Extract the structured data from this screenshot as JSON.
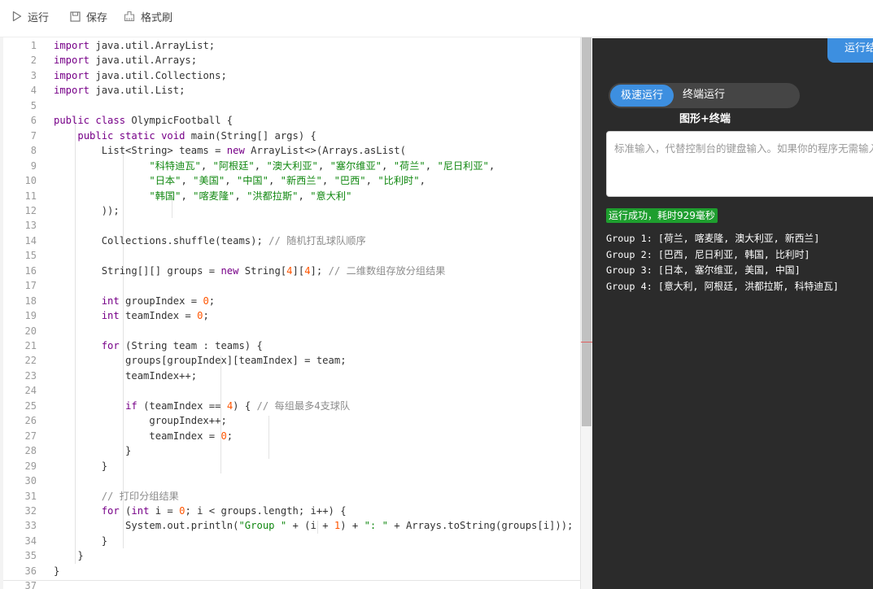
{
  "toolbar": {
    "run": "运行",
    "save": "保存",
    "format": "格式刷"
  },
  "colors": {
    "keyword": "#770088",
    "type": "#0055aa",
    "string": "#118811",
    "number": "#ff5500",
    "comment": "#8c8c8c",
    "accent": "#3d8fe0",
    "success": "#1e9e2e"
  },
  "editor": {
    "lines": [
      [
        [
          "kw",
          "import"
        ],
        [
          "p",
          " java.util.ArrayList;"
        ]
      ],
      [
        [
          "kw",
          "import"
        ],
        [
          "p",
          " java.util.Arrays;"
        ]
      ],
      [
        [
          "kw",
          "import"
        ],
        [
          "p",
          " java.util.Collections;"
        ]
      ],
      [
        [
          "kw",
          "import"
        ],
        [
          "p",
          " java.util.List;"
        ]
      ],
      [],
      [
        [
          "kw",
          "public class"
        ],
        [
          "p",
          " OlympicFootball {"
        ]
      ],
      [
        [
          "p",
          "    "
        ],
        [
          "kw",
          "public static void"
        ],
        [
          "p",
          " main(String[] args) {"
        ]
      ],
      [
        [
          "p",
          "        List<String> teams = "
        ],
        [
          "kw",
          "new"
        ],
        [
          "p",
          " ArrayList<>(Arrays.asList("
        ]
      ],
      [
        [
          "p",
          "                "
        ],
        [
          "str",
          "\"科特迪瓦\""
        ],
        [
          "p",
          ", "
        ],
        [
          "str",
          "\"阿根廷\""
        ],
        [
          "p",
          ", "
        ],
        [
          "str",
          "\"澳大利亚\""
        ],
        [
          "p",
          ", "
        ],
        [
          "str",
          "\"塞尔维亚\""
        ],
        [
          "p",
          ", "
        ],
        [
          "str",
          "\"荷兰\""
        ],
        [
          "p",
          ", "
        ],
        [
          "str",
          "\"尼日利亚\""
        ],
        [
          "p",
          ","
        ]
      ],
      [
        [
          "p",
          "                "
        ],
        [
          "str",
          "\"日本\""
        ],
        [
          "p",
          ", "
        ],
        [
          "str",
          "\"美国\""
        ],
        [
          "p",
          ", "
        ],
        [
          "str",
          "\"中国\""
        ],
        [
          "p",
          ", "
        ],
        [
          "str",
          "\"新西兰\""
        ],
        [
          "p",
          ", "
        ],
        [
          "str",
          "\"巴西\""
        ],
        [
          "p",
          ", "
        ],
        [
          "str",
          "\"比利时\""
        ],
        [
          "p",
          ","
        ]
      ],
      [
        [
          "p",
          "                "
        ],
        [
          "str",
          "\"韩国\""
        ],
        [
          "p",
          ", "
        ],
        [
          "str",
          "\"喀麦隆\""
        ],
        [
          "p",
          ", "
        ],
        [
          "str",
          "\"洪都拉斯\""
        ],
        [
          "p",
          ", "
        ],
        [
          "str",
          "\"意大利\""
        ]
      ],
      [
        [
          "p",
          "        ));"
        ]
      ],
      [],
      [
        [
          "p",
          "        Collections.shuffle(teams); "
        ],
        [
          "cm",
          "// 随机打乱球队顺序"
        ]
      ],
      [],
      [
        [
          "p",
          "        String[][] groups = "
        ],
        [
          "kw",
          "new"
        ],
        [
          "p",
          " String["
        ],
        [
          "num",
          "4"
        ],
        [
          "p",
          "]["
        ],
        [
          "num",
          "4"
        ],
        [
          "p",
          "]; "
        ],
        [
          "cm",
          "// 二维数组存放分组结果"
        ]
      ],
      [],
      [
        [
          "p",
          "        "
        ],
        [
          "kw",
          "int"
        ],
        [
          "p",
          " groupIndex = "
        ],
        [
          "num",
          "0"
        ],
        [
          "p",
          ";"
        ]
      ],
      [
        [
          "p",
          "        "
        ],
        [
          "kw",
          "int"
        ],
        [
          "p",
          " teamIndex = "
        ],
        [
          "num",
          "0"
        ],
        [
          "p",
          ";"
        ]
      ],
      [],
      [
        [
          "p",
          "        "
        ],
        [
          "kw",
          "for"
        ],
        [
          "p",
          " (String team : teams) {"
        ]
      ],
      [
        [
          "p",
          "            groups[groupIndex][teamIndex] = team;"
        ]
      ],
      [
        [
          "p",
          "            teamIndex++;"
        ]
      ],
      [],
      [
        [
          "p",
          "            "
        ],
        [
          "kw",
          "if"
        ],
        [
          "p",
          " (teamIndex == "
        ],
        [
          "num",
          "4"
        ],
        [
          "p",
          ") { "
        ],
        [
          "cm",
          "// 每组最多4支球队"
        ]
      ],
      [
        [
          "p",
          "                groupIndex++;"
        ]
      ],
      [
        [
          "p",
          "                teamIndex = "
        ],
        [
          "num",
          "0"
        ],
        [
          "p",
          ";"
        ]
      ],
      [
        [
          "p",
          "            }"
        ]
      ],
      [
        [
          "p",
          "        }"
        ]
      ],
      [],
      [
        [
          "p",
          "        "
        ],
        [
          "cm",
          "// 打印分组结果"
        ]
      ],
      [
        [
          "p",
          "        "
        ],
        [
          "kw",
          "for"
        ],
        [
          "p",
          " ("
        ],
        [
          "kw",
          "int"
        ],
        [
          "p",
          " i = "
        ],
        [
          "num",
          "0"
        ],
        [
          "p",
          "; i < groups.length; i++) {"
        ]
      ],
      [
        [
          "p",
          "            System.out.println("
        ],
        [
          "str",
          "\"Group \""
        ],
        [
          "p",
          " + (i + "
        ],
        [
          "num",
          "1"
        ],
        [
          "p",
          ") + "
        ],
        [
          "str",
          "\": \""
        ],
        [
          "p",
          " + Arrays.toString(groups[i]));"
        ]
      ],
      [
        [
          "p",
          "        }"
        ]
      ],
      [
        [
          "p",
          "    }"
        ]
      ],
      [
        [
          "p",
          "}"
        ]
      ],
      []
    ]
  },
  "panel": {
    "run_button": "运行结果",
    "mode_fast": "极速运行",
    "mode_terminal": "终端运行",
    "mode_graphic": "图形+终端",
    "stdin_placeholder": "标准输入，代替控制台的键盘输入。如果你的程序无需输入，可不填",
    "status": "运行成功，耗时929毫秒",
    "output": [
      "Group 1: [荷兰, 喀麦隆, 澳大利亚, 新西兰]",
      "Group 2: [巴西, 尼日利亚, 韩国, 比利时]",
      "Group 3: [日本, 塞尔维亚, 美国, 中国]",
      "Group 4: [意大利, 阿根廷, 洪都拉斯, 科特迪瓦]"
    ]
  }
}
